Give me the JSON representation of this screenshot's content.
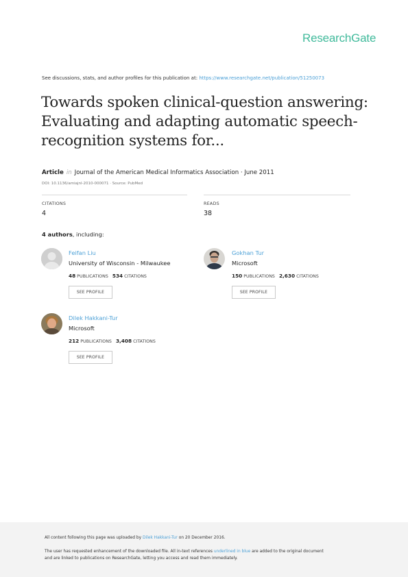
{
  "brand": "ResearchGate",
  "header": {
    "see_text": "See discussions, stats, and author profiles for this publication at: ",
    "url": "https://www.researchgate.net/publication/51250073"
  },
  "title": {
    "line1": "Towards spoken clinical-question answering:",
    "line2": "Evaluating and adapting automatic speech-",
    "line3": "recognition systems for..."
  },
  "article": {
    "type": "Article",
    "in": "in",
    "journal": "Journal of the American Medical Informatics Association · June 2011",
    "doi": "DOI: 10.1136/amiajnl-2010-000071 · Source: PubMed"
  },
  "stats": {
    "citations_label": "CITATIONS",
    "citations_value": "4",
    "reads_label": "READS",
    "reads_value": "38"
  },
  "authors_head": {
    "count": "4 authors",
    "suffix": ", including:"
  },
  "authors": [
    {
      "name": "Feifan Liu",
      "affiliation": "University of Wisconsin - Milwaukee",
      "pubs": "48",
      "pubs_label": "PUBLICATIONS",
      "cites": "534",
      "cites_label": "CITATIONS",
      "button": "SEE PROFILE",
      "avatar": "default-avatar-icon"
    },
    {
      "name": "Gokhan Tur",
      "affiliation": "Microsoft",
      "pubs": "150",
      "pubs_label": "PUBLICATIONS",
      "cites": "2,630",
      "cites_label": "CITATIONS",
      "button": "SEE PROFILE",
      "avatar": "photo"
    },
    {
      "name": "Dilek Hakkani-Tur",
      "affiliation": "Microsoft",
      "pubs": "212",
      "pubs_label": "PUBLICATIONS",
      "cites": "3,408",
      "cites_label": "CITATIONS",
      "button": "SEE PROFILE",
      "avatar": "photo"
    }
  ],
  "footer": {
    "line1_pre": "All content following this page was uploaded by ",
    "line1_name": "Dilek Hakkani-Tur",
    "line1_post": " on 20 December 2016.",
    "line2_pre": "The user has requested enhancement of the downloaded file. All in-text references ",
    "line2_link": "underlined in blue",
    "line2_post": " are added to the original document",
    "line3": "and are linked to publications on ResearchGate, letting you access and read them immediately."
  },
  "colors": {
    "brand": "#40ba9b",
    "link": "#4a9fd6",
    "footer_bg": "#f3f3f3"
  }
}
